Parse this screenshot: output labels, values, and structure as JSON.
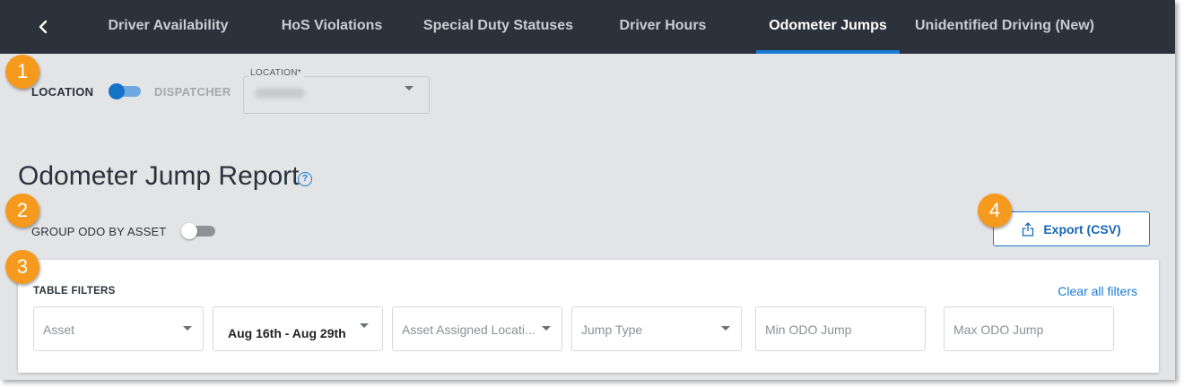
{
  "nav": {
    "back_icon": "chevron-left-icon",
    "tabs": [
      {
        "label": "Driver Availability"
      },
      {
        "label": "HoS Violations"
      },
      {
        "label": "Special Duty Statuses"
      },
      {
        "label": "Driver Hours"
      },
      {
        "label": "Odometer Jumps",
        "active": true
      },
      {
        "label": "Unidentified Driving (New)"
      }
    ]
  },
  "callouts": [
    "1",
    "2",
    "3",
    "4"
  ],
  "mode_toggle": {
    "left_label": "LOCATION",
    "right_label": "DISPATCHER",
    "selected": "LOCATION"
  },
  "location_select": {
    "legend": "LOCATION*"
  },
  "report": {
    "title": "Odometer Jump Report",
    "help_icon": "help-circle-icon"
  },
  "group_toggle": {
    "label": "GROUP ODO BY ASSET",
    "on": false
  },
  "export": {
    "label": "Export (CSV)",
    "icon": "share-upload-icon"
  },
  "filters": {
    "title": "TABLE FILTERS",
    "clear_label": "Clear all filters",
    "asset": {
      "placeholder": "Asset"
    },
    "date_range": {
      "value": "Aug 16th - Aug 29th"
    },
    "assigned_location": {
      "placeholder": "Asset Assigned Locati..."
    },
    "jump_type": {
      "placeholder": "Jump Type"
    },
    "min_odo": {
      "placeholder": "Min ODO Jump"
    },
    "max_odo": {
      "placeholder": "Max ODO Jump"
    }
  },
  "colors": {
    "nav_bg": "#2b323b",
    "accent": "#1a7bd3",
    "callout": "#f59a1d",
    "page_bg": "#e3e4e6"
  }
}
